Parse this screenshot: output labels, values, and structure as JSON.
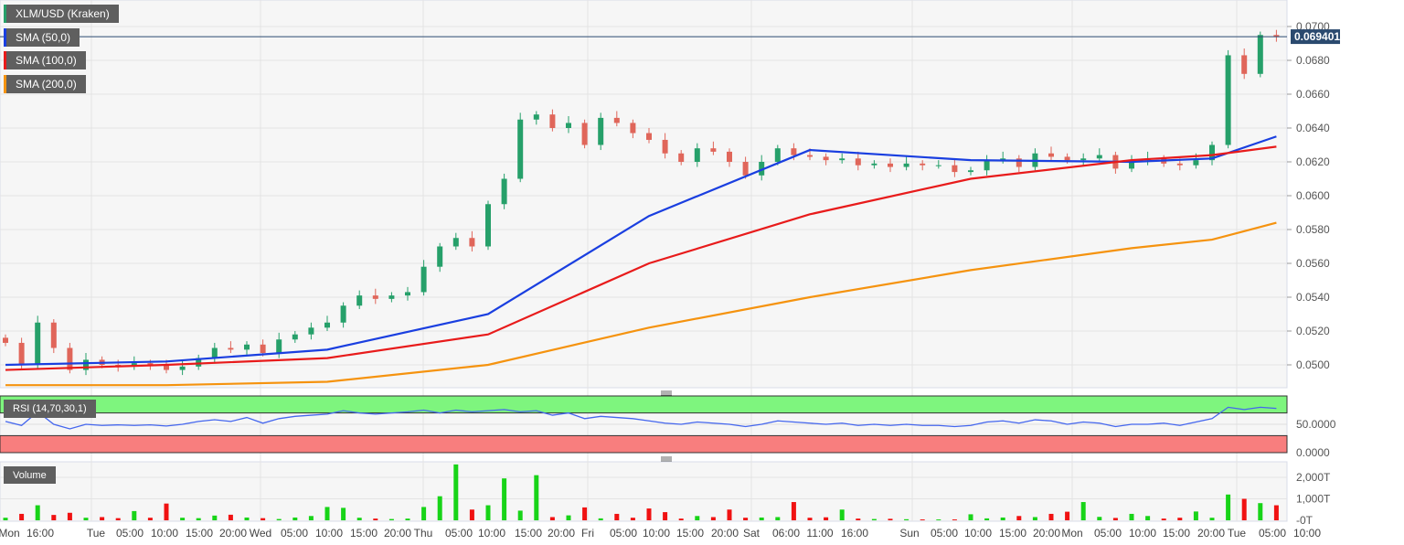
{
  "legend": {
    "symbol": "XLM/USD (Kraken)",
    "sma50": "SMA (50,0)",
    "sma100": "SMA (100,0)",
    "sma200": "SMA (200,0)",
    "rsi": "RSI (14,70,30,1)",
    "volume": "Volume"
  },
  "colors": {
    "up": "#26a06a",
    "down": "#e0665a",
    "sma50": "#1a3fe0",
    "sma100": "#e81b1b",
    "sma200": "#f5930f",
    "rsi_line": "#4466ee",
    "rsi_over": "#7ef57e",
    "rsi_under": "#f87e7e",
    "vol_up": "#18d418",
    "vol_down": "#f01212",
    "price_tag": "#2b4a6f"
  },
  "chart_data": [
    {
      "type": "candlestick",
      "title": "XLM/USD (Kraken)",
      "last_price": "0.069401",
      "ylim": [
        0.0487,
        0.0715
      ],
      "y_ticks": [
        "0.0700",
        "0.0680",
        "0.0660",
        "0.0640",
        "0.0620",
        "0.0600",
        "0.0580",
        "0.0560",
        "0.0540",
        "0.0520",
        "0.0500"
      ],
      "x_ticks": [
        "Mon",
        "16:00",
        "Tue",
        "05:00",
        "10:00",
        "15:00",
        "20:00",
        "Wed",
        "05:00",
        "10:00",
        "15:00",
        "20:00",
        "Thu",
        "05:00",
        "10:00",
        "15:00",
        "20:00",
        "Fri",
        "05:00",
        "10:00",
        "15:00",
        "20:00",
        "Sat",
        "06:00",
        "11:00",
        "16:00",
        "Sun",
        "05:00",
        "10:00",
        "15:00",
        "20:00",
        "Mon",
        "05:00",
        "10:00",
        "15:00",
        "20:00",
        "Tue",
        "05:00",
        "10:00"
      ],
      "close": [
        0.0513,
        0.05,
        0.0525,
        0.051,
        0.0497,
        0.0503,
        0.05,
        0.0499,
        0.0501,
        0.05,
        0.0497,
        0.0499,
        0.0504,
        0.051,
        0.0509,
        0.0512,
        0.0507,
        0.0515,
        0.0518,
        0.0522,
        0.0525,
        0.0535,
        0.0541,
        0.0539,
        0.0541,
        0.0543,
        0.0558,
        0.057,
        0.0575,
        0.057,
        0.0595,
        0.061,
        0.0645,
        0.0648,
        0.064,
        0.0643,
        0.063,
        0.0646,
        0.0643,
        0.0637,
        0.0633,
        0.0625,
        0.062,
        0.0628,
        0.0626,
        0.062,
        0.0612,
        0.062,
        0.0628,
        0.0624,
        0.0623,
        0.0621,
        0.0622,
        0.0618,
        0.0619,
        0.0617,
        0.0619,
        0.0618,
        0.0618,
        0.0614,
        0.0615,
        0.0621,
        0.0622,
        0.0617,
        0.0625,
        0.0623,
        0.0621,
        0.0622,
        0.0624,
        0.0616,
        0.0621,
        0.0622,
        0.0619,
        0.0618,
        0.0621,
        0.063,
        0.0683,
        0.0672,
        0.0695,
        0.0694
      ],
      "sma": [
        {
          "name": "SMA (50,0)",
          "idx": [
            0,
            10,
            20,
            30,
            40,
            50,
            60,
            70,
            75,
            79
          ],
          "values": [
            0.05,
            0.0502,
            0.0509,
            0.053,
            0.0588,
            0.0627,
            0.0621,
            0.062,
            0.0622,
            0.0635
          ]
        },
        {
          "name": "SMA (100,0)",
          "idx": [
            0,
            10,
            20,
            30,
            40,
            50,
            60,
            70,
            75,
            79
          ],
          "values": [
            0.0497,
            0.05,
            0.0504,
            0.0518,
            0.056,
            0.0589,
            0.061,
            0.0621,
            0.0624,
            0.0629
          ]
        },
        {
          "name": "SMA (200,0)",
          "idx": [
            0,
            10,
            20,
            30,
            40,
            50,
            60,
            70,
            75,
            79
          ],
          "values": [
            0.0488,
            0.0488,
            0.049,
            0.05,
            0.0522,
            0.054,
            0.0556,
            0.0569,
            0.0574,
            0.0584
          ]
        }
      ]
    },
    {
      "type": "line",
      "title": "RSI (14,70,30,1)",
      "ylim": [
        0,
        100
      ],
      "y_ticks": [
        "50.0000",
        "0.0000"
      ],
      "values": [
        55,
        48,
        72,
        50,
        42,
        50,
        48,
        49,
        48,
        49,
        47,
        50,
        55,
        58,
        55,
        62,
        52,
        60,
        64,
        66,
        68,
        74,
        70,
        68,
        70,
        72,
        75,
        70,
        75,
        72,
        74,
        76,
        72,
        74,
        66,
        70,
        60,
        64,
        62,
        60,
        56,
        52,
        50,
        54,
        52,
        50,
        46,
        50,
        56,
        54,
        52,
        50,
        52,
        48,
        50,
        48,
        50,
        48,
        48,
        46,
        48,
        54,
        56,
        52,
        58,
        56,
        50,
        54,
        52,
        46,
        50,
        50,
        52,
        48,
        54,
        60,
        80,
        76,
        80,
        78
      ]
    },
    {
      "type": "bar",
      "title": "Volume",
      "ylim": [
        0,
        2700
      ],
      "y_ticks": [
        "2,000T",
        "1,000T",
        "-0T"
      ],
      "values": [
        120,
        300,
        700,
        250,
        350,
        120,
        150,
        100,
        430,
        120,
        780,
        120,
        100,
        220,
        260,
        130,
        100,
        60,
        130,
        200,
        620,
        580,
        120,
        80,
        60,
        80,
        620,
        1120,
        2600,
        500,
        700,
        1950,
        450,
        2100,
        150,
        230,
        600,
        90,
        300,
        120,
        550,
        380,
        80,
        200,
        150,
        500,
        120,
        130,
        150,
        850,
        120,
        140,
        500,
        80,
        60,
        70,
        50,
        40,
        40,
        40,
        280,
        90,
        130,
        200,
        150,
        300,
        400,
        850,
        160,
        110,
        300,
        200,
        80,
        120,
        410,
        120,
        1200,
        1000,
        800,
        700
      ]
    }
  ]
}
